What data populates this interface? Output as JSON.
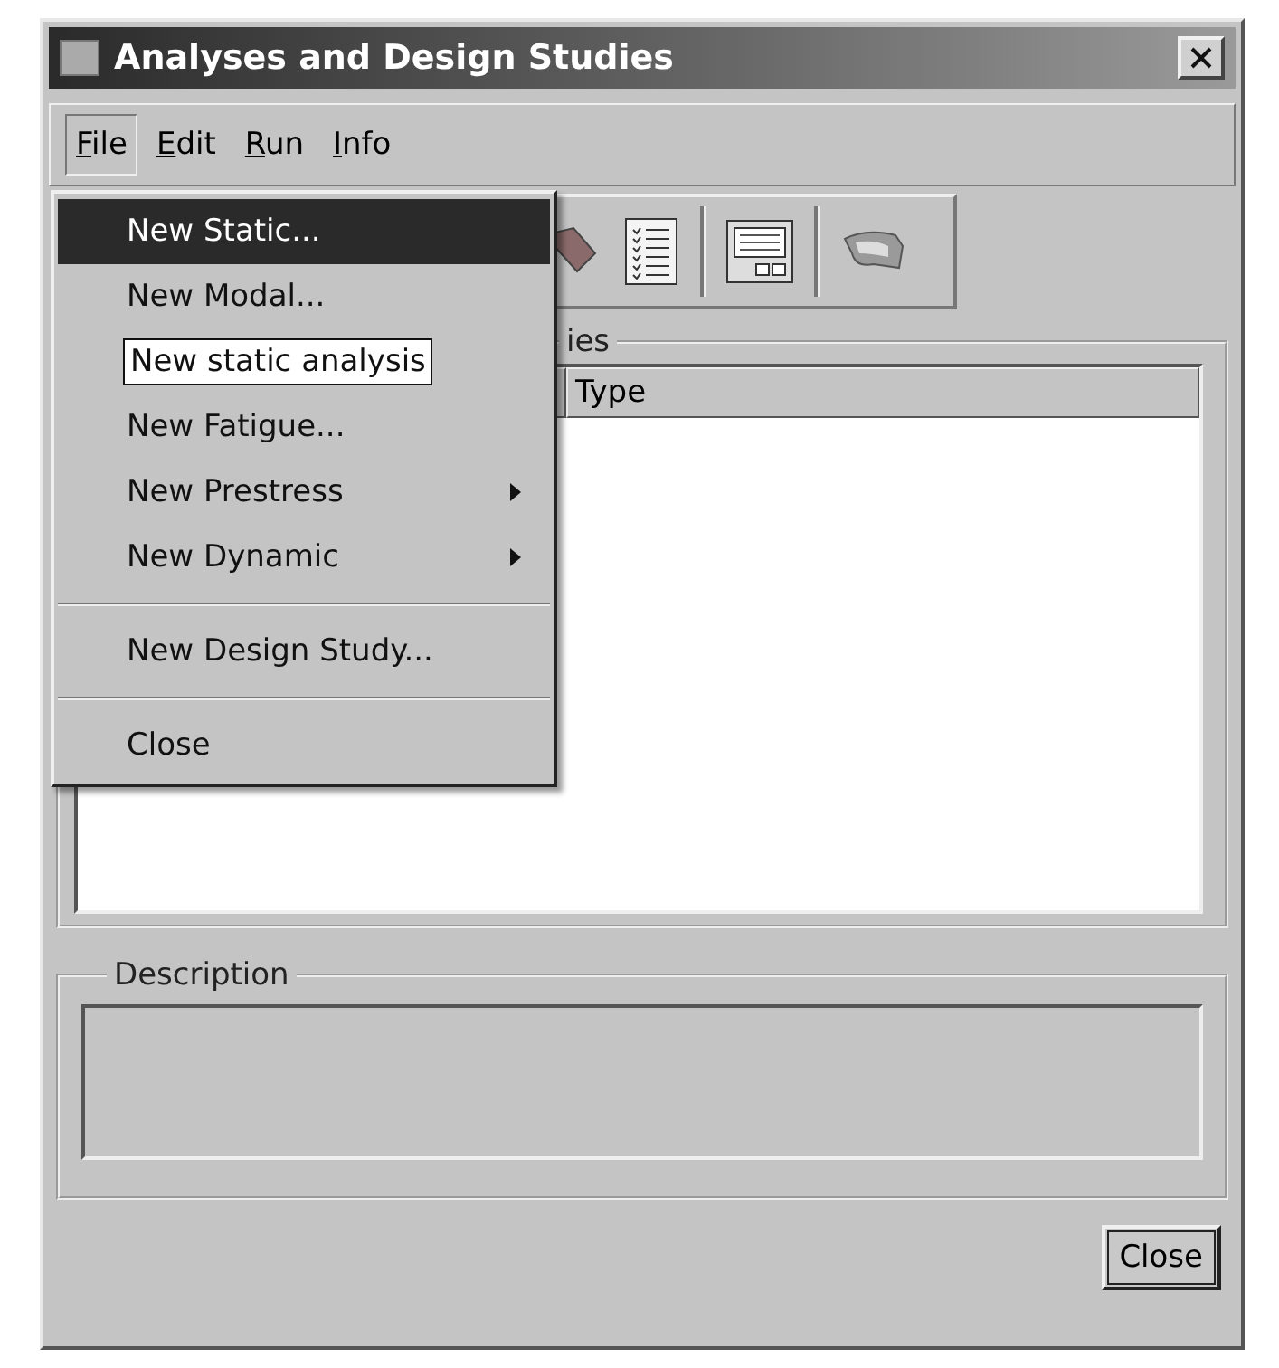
{
  "window": {
    "title": "Analyses and Design Studies"
  },
  "menu_bar": [
    {
      "label": "File",
      "selected": true
    },
    {
      "label": "Edit",
      "selected": false
    },
    {
      "label": "Run",
      "selected": false
    },
    {
      "label": "Info",
      "selected": false
    }
  ],
  "file_menu": [
    {
      "kind": "item",
      "label": "New Static...",
      "selected": true,
      "submenu": false
    },
    {
      "kind": "item",
      "label": "New Modal...",
      "selected": false,
      "submenu": false
    },
    {
      "kind": "tooltip",
      "label": "New static analysis"
    },
    {
      "kind": "item",
      "label": "New Fatigue...",
      "selected": false,
      "submenu": false
    },
    {
      "kind": "item",
      "label": "New Prestress",
      "selected": false,
      "submenu": true
    },
    {
      "kind": "item",
      "label": "New Dynamic",
      "selected": false,
      "submenu": true
    },
    {
      "kind": "separator"
    },
    {
      "kind": "item",
      "label": "New Design Study...",
      "selected": false,
      "submenu": false
    },
    {
      "kind": "separator"
    },
    {
      "kind": "item",
      "label": "Close",
      "selected": false,
      "submenu": false
    }
  ],
  "studies_group": {
    "title": "ies",
    "columns": [
      "Type"
    ]
  },
  "description_group": {
    "title": "Description"
  },
  "buttons": [
    "Close"
  ]
}
